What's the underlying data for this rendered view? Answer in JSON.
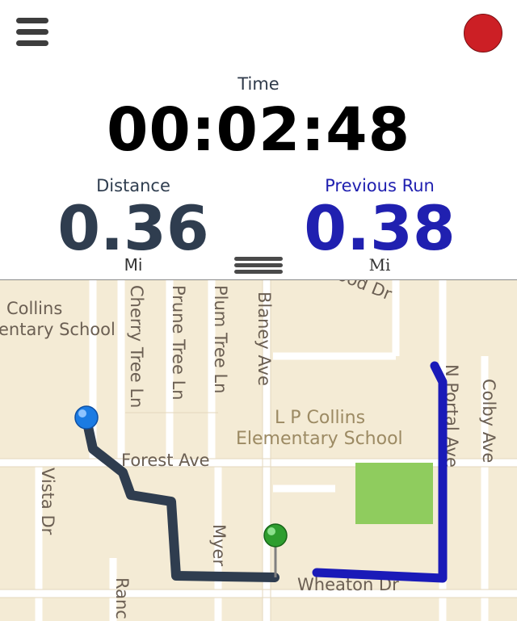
{
  "header": {
    "menu_icon": "hamburger-menu-icon",
    "record_icon": "record-icon",
    "record_color": "#cc1f25"
  },
  "time": {
    "label": "Time",
    "value": "00:02:48"
  },
  "distance": {
    "label": "Distance",
    "value": "0.36",
    "unit": "Mi",
    "color": "#2f3d4f"
  },
  "previous_run": {
    "label": "Previous Run",
    "value": "0.38",
    "unit": "Mi",
    "color": "#2020b0"
  },
  "drag_handle_icon": "drag-handle-icon",
  "map": {
    "street_labels": {
      "collins_top": "Collins",
      "collins_school_partial": "entary School",
      "cherry": "Cherry Tree Ln",
      "prune": "Prune Tree Ln",
      "plum": "Plum Tree Ln",
      "blaney": "Blaney Ave",
      "wood": "wood Dr",
      "school_line1": "L P Collins",
      "school_line2": "Elementary School",
      "forest": "Forest Ave",
      "vista": "Vista Dr",
      "myer": "Myer",
      "ranch": "Ranc",
      "wheaton": "Wheaton Dr",
      "portal": "N Portal Ave",
      "colby": "Colby Ave"
    },
    "current_route_color": "#2f3d4f",
    "previous_route_color": "#1a1ab8",
    "start_pin_icon": "blue-pin-icon",
    "current_pin_icon": "green-pin-icon"
  }
}
